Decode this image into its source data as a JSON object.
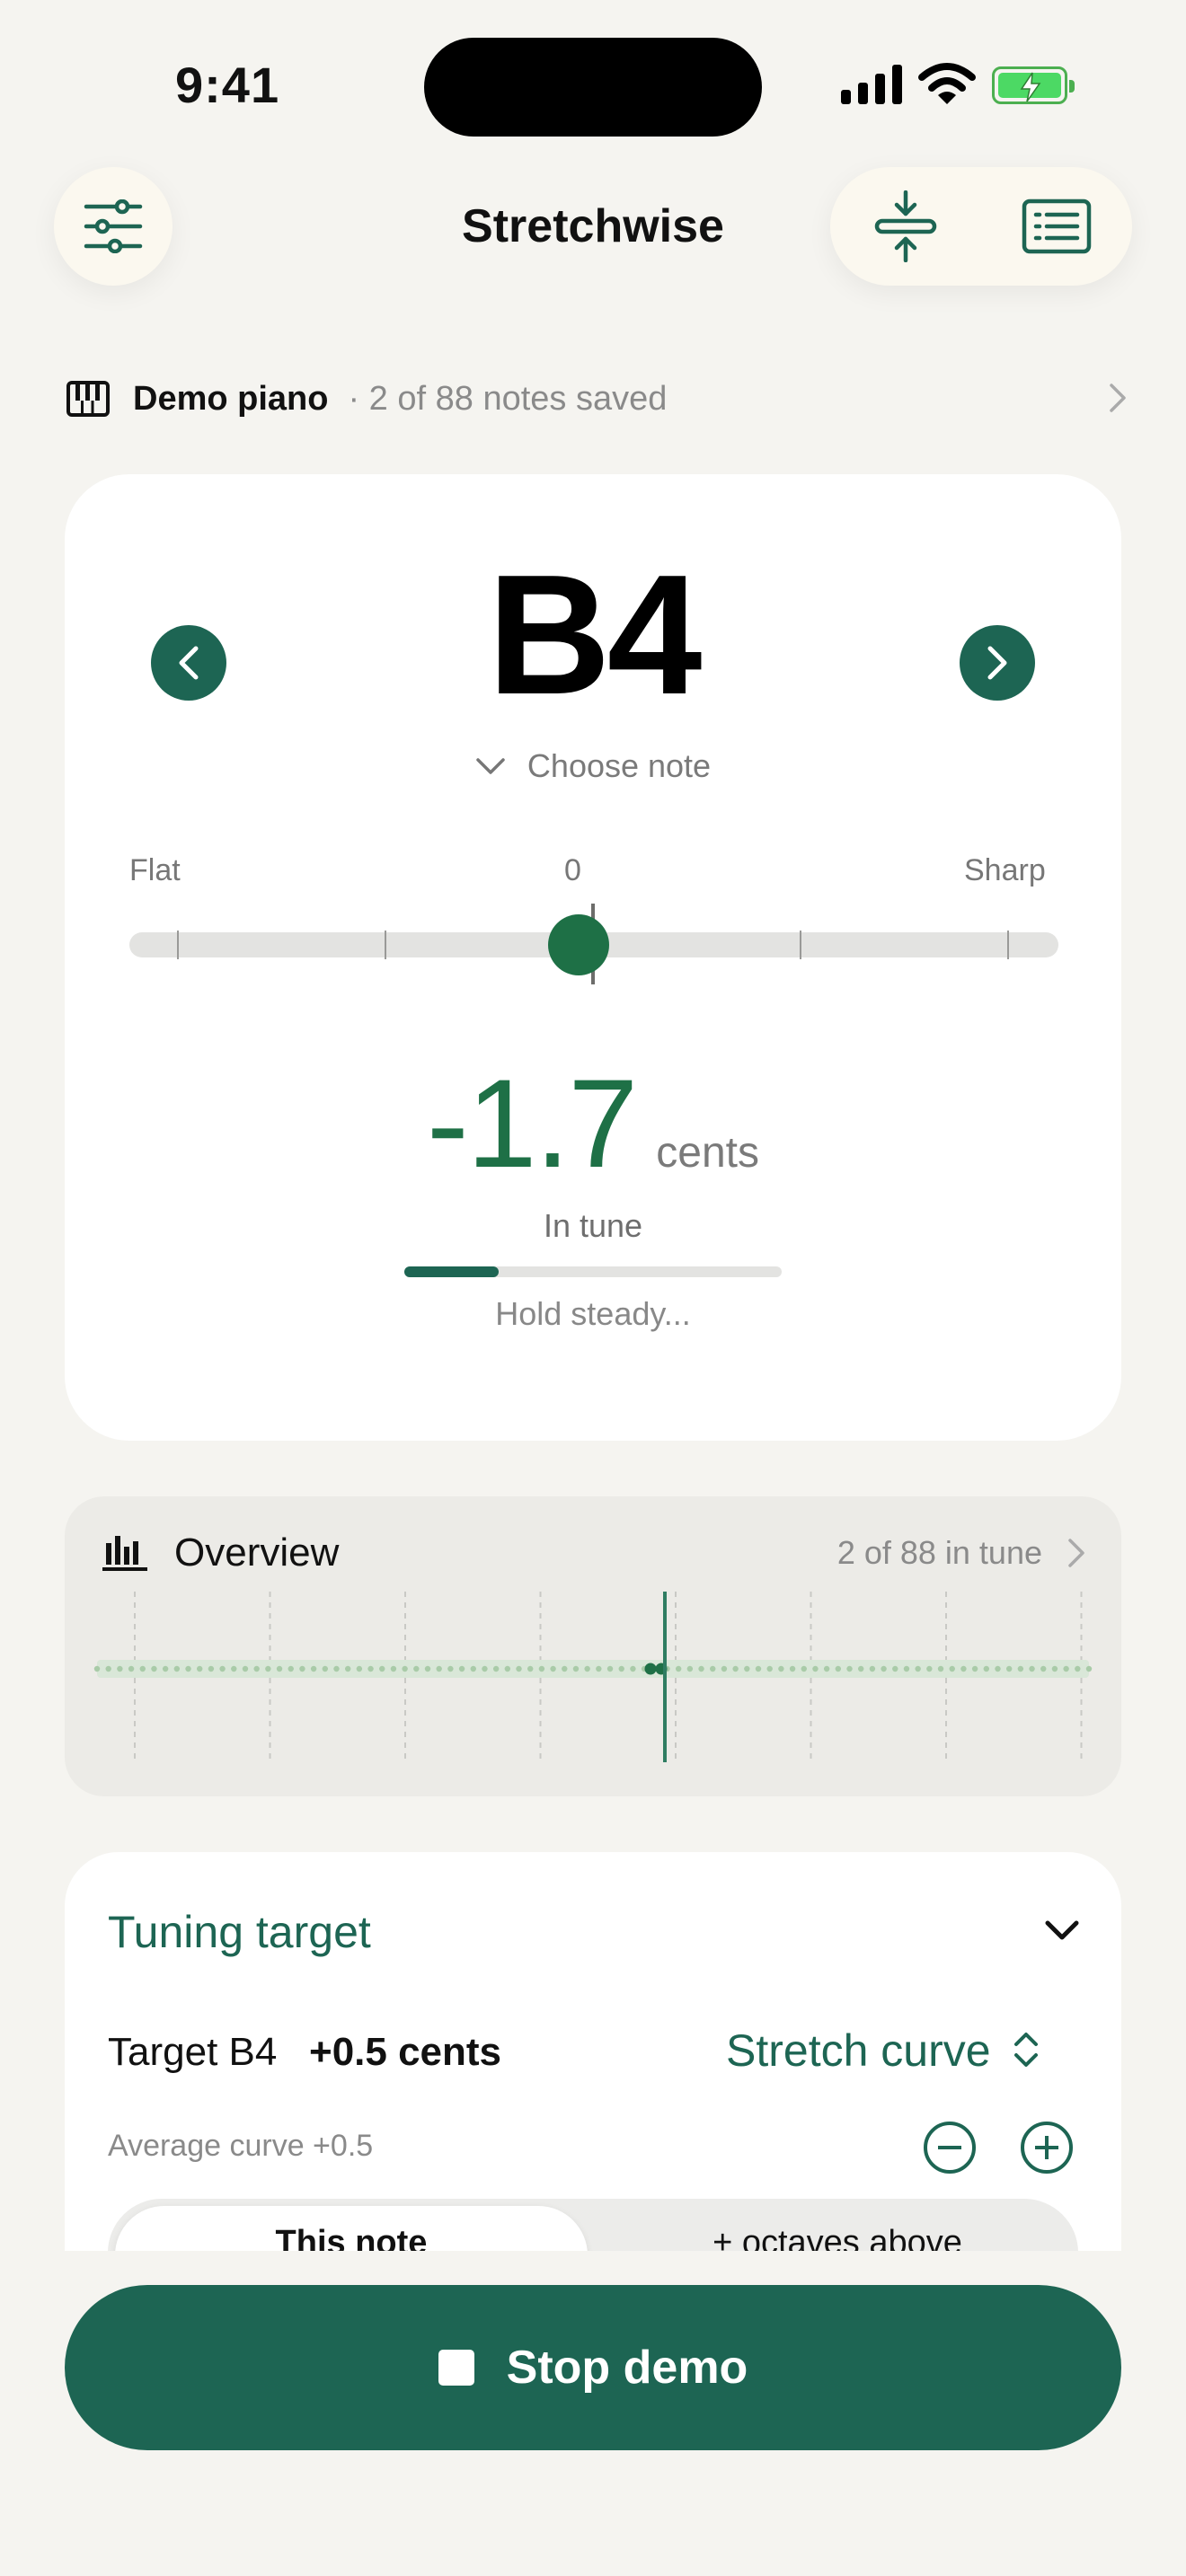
{
  "status_bar": {
    "time": "9:41"
  },
  "header": {
    "title": "Stretchwise"
  },
  "piano": {
    "name": "Demo piano",
    "notes_saved": "· 2 of 88 notes saved"
  },
  "tuner": {
    "note": "B4",
    "choose_note": "Choose note",
    "meter": {
      "flat_label": "Flat",
      "zero_label": "0",
      "sharp_label": "Sharp"
    },
    "cents_value": "-1.7",
    "cents_unit": "cents",
    "status": "In tune",
    "hold_progress": 0.25,
    "hold_text": "Hold steady..."
  },
  "overview": {
    "title": "Overview",
    "count": "2 of 88 in tune",
    "tuned_notes": 2,
    "total_notes": 88
  },
  "tuning_target": {
    "title": "Tuning target",
    "target_label": "Target B4",
    "target_cents": "+0.5 cents",
    "curve_select": "Stretch curve",
    "average_curve": "Average curve +0.5",
    "segment": {
      "option_1": "This note",
      "option_2": "+ octaves above",
      "selected": "This note"
    }
  },
  "cta": {
    "label": "Stop demo"
  },
  "colors": {
    "accent": "#1d6553",
    "in_tune_green": "#1e7046",
    "background": "#f5f4f0"
  },
  "icons": {
    "settings": "sliders-icon",
    "center": "compress-vertical-icon",
    "list": "list-card-icon",
    "piano": "piano-icon",
    "overview": "bar-chart-icon"
  }
}
